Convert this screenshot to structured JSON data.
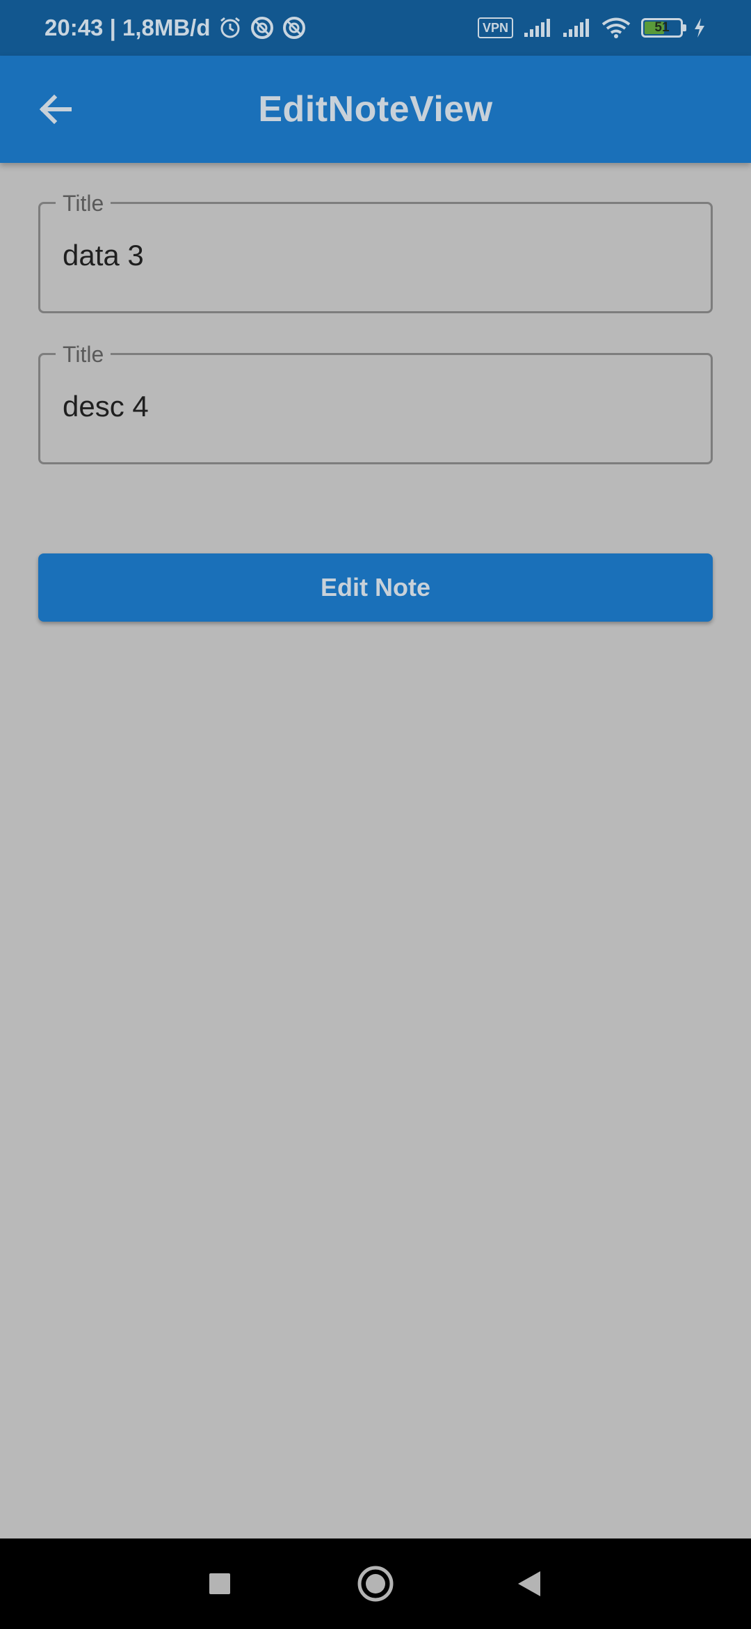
{
  "status_bar": {
    "time_and_data": "20:43 | 1,8MB/d",
    "vpn": "VPN",
    "battery_level": "51"
  },
  "app_bar": {
    "title": "EditNoteView",
    "back_icon": "arrow-left-icon"
  },
  "form": {
    "title_field": {
      "label": "Title",
      "value": "data 3"
    },
    "description_field": {
      "label": "Title",
      "value": "desc 4"
    },
    "submit_label": "Edit Note"
  },
  "nav_bar": {
    "icons": [
      "square-recents-icon",
      "circle-home-icon",
      "triangle-back-icon"
    ]
  },
  "colors": {
    "primary": "#1a70b9",
    "status_bar": "#12578f",
    "background": "#b9b9b9"
  }
}
